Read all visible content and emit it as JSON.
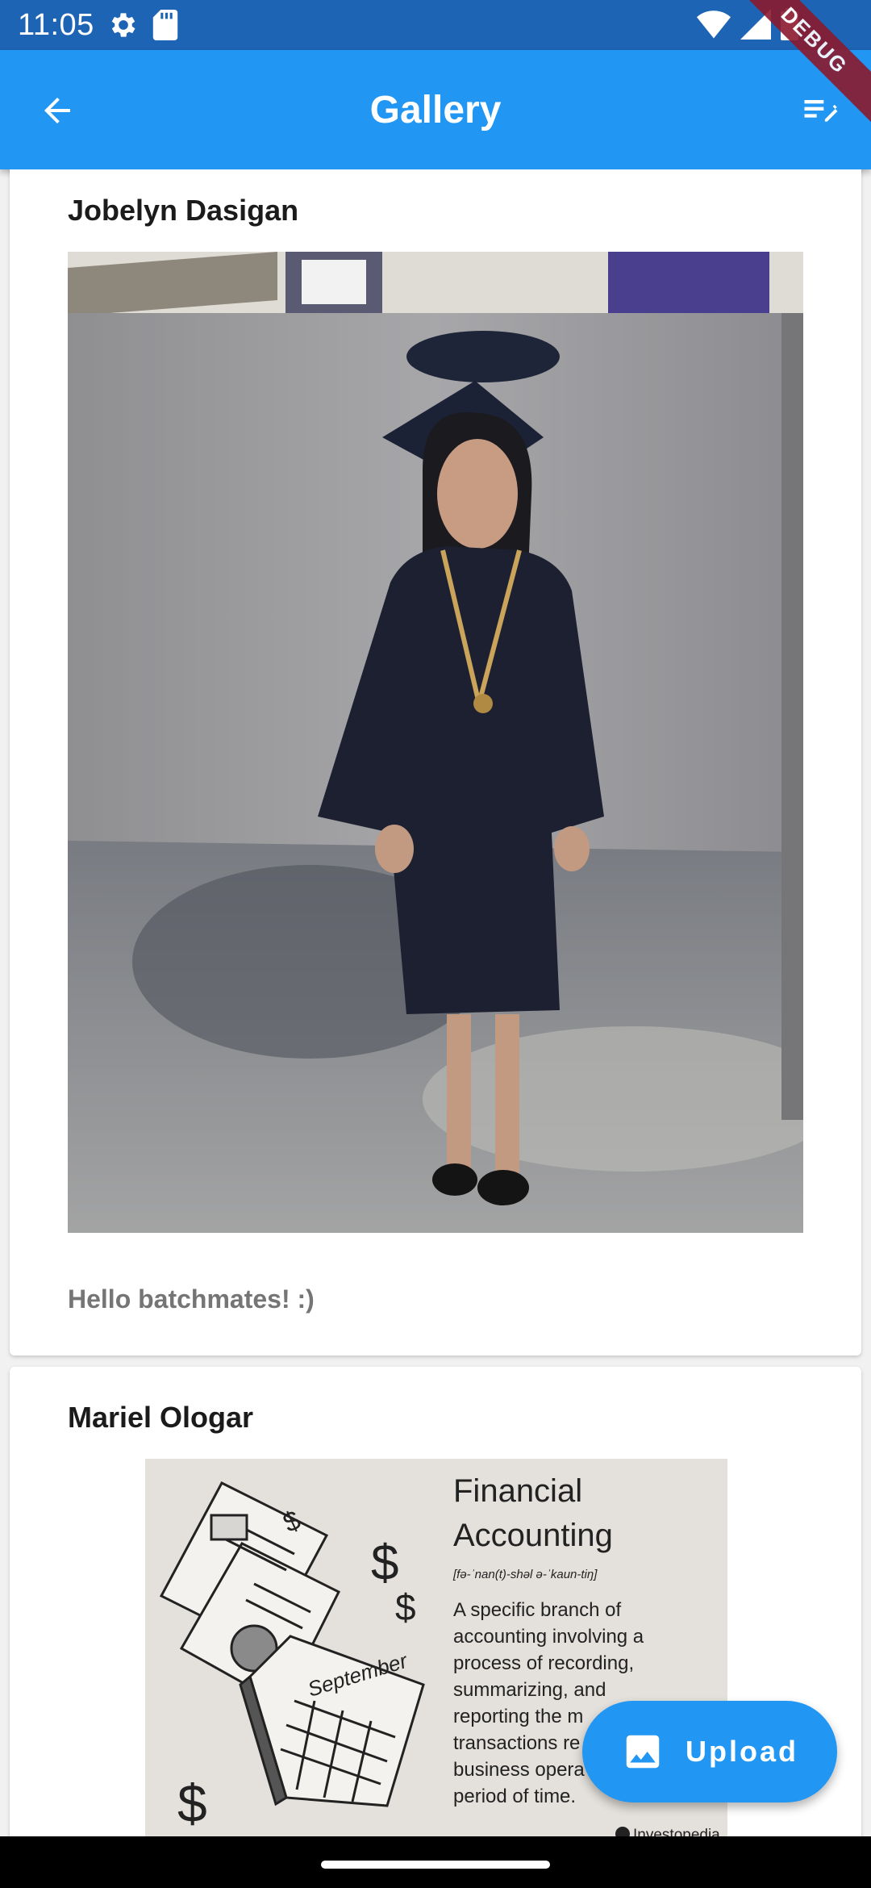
{
  "status_bar": {
    "time": "11:05",
    "icons": [
      "settings-icon",
      "sd-card-icon",
      "wifi-icon",
      "signal-icon",
      "battery-icon"
    ]
  },
  "app_bar": {
    "title": "Gallery",
    "back_icon": "arrow-back-icon",
    "action_icon": "edit-list-icon",
    "debug_banner": "DEBUG"
  },
  "posts": [
    {
      "author": "Jobelyn Dasigan",
      "caption": "Hello batchmates! :)",
      "image": "graduation-photo"
    },
    {
      "author": "Mariel Ologar",
      "image": "financial-accounting-infographic",
      "image_text": {
        "title_line1": "Financial",
        "title_line2": "Accounting",
        "pronunciation": "[fə-ˈnan(t)-shəl ə-ˈkaun-tiŋ]",
        "body_lines": [
          "A specific branch of",
          "accounting involving a",
          "process of recording,",
          "summarizing, and",
          "reporting the m",
          "transactions re",
          "business opera",
          "period of time."
        ],
        "calendar_label": "September",
        "brand": "Investopedia"
      }
    }
  ],
  "fab": {
    "label": "Upload",
    "icon": "image-icon"
  },
  "colors": {
    "primary": "#2196f3",
    "status_bar": "#1e64b5",
    "debug_banner": "#8b1a2e"
  }
}
